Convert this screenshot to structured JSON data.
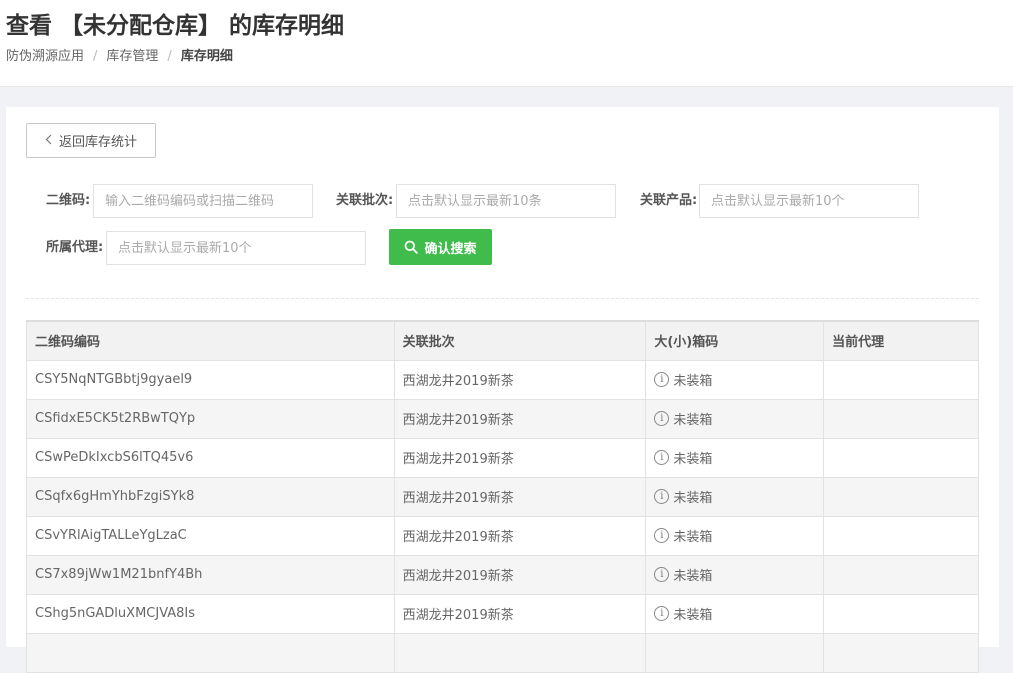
{
  "header": {
    "title": "查看 【未分配仓库】 的库存明细",
    "breadcrumb": [
      "防伪溯源应用",
      "库存管理",
      "库存明细"
    ]
  },
  "toolbar": {
    "back_label": "返回库存统计"
  },
  "filters": {
    "qrcode": {
      "label": "二维码:",
      "placeholder": "输入二维码编码或扫描二维码"
    },
    "batch": {
      "label": "关联批次:",
      "placeholder": "点击默认显示最新10条"
    },
    "product": {
      "label": "关联产品:",
      "placeholder": "点击默认显示最新10个"
    },
    "agent": {
      "label": "所属代理:",
      "placeholder": "点击默认显示最新10个"
    },
    "search_label": "确认搜索"
  },
  "table": {
    "columns": [
      "二维码编码",
      "关联批次",
      "大(小)箱码",
      "当前代理"
    ],
    "rows": [
      {
        "code": "CSY5NqNTGBbtj9gyael9",
        "batch": "西湖龙井2019新茶",
        "box": "未装箱",
        "agent": ""
      },
      {
        "code": "CSfidxE5CK5t2RBwTQYp",
        "batch": "西湖龙井2019新茶",
        "box": "未装箱",
        "agent": ""
      },
      {
        "code": "CSwPeDkIxcbS6lTQ45v6",
        "batch": "西湖龙井2019新茶",
        "box": "未装箱",
        "agent": ""
      },
      {
        "code": "CSqfx6gHmYhbFzgiSYk8",
        "batch": "西湖龙井2019新茶",
        "box": "未装箱",
        "agent": ""
      },
      {
        "code": "CSvYRlAigTALLeYgLzaC",
        "batch": "西湖龙井2019新茶",
        "box": "未装箱",
        "agent": ""
      },
      {
        "code": "CS7x89jWw1M21bnfY4Bh",
        "batch": "西湖龙井2019新茶",
        "box": "未装箱",
        "agent": ""
      },
      {
        "code": "CShg5nGADluXMCJVA8Is",
        "batch": "西湖龙井2019新茶",
        "box": "未装箱",
        "agent": ""
      },
      {
        "code": "",
        "batch": "",
        "box": "",
        "agent": ""
      }
    ]
  },
  "icons": {
    "back": "chevron-left-icon",
    "search": "search-icon",
    "status": "info-icon"
  },
  "colors": {
    "primary_green": "#3fbc4b",
    "background": "#f0f2f5"
  }
}
